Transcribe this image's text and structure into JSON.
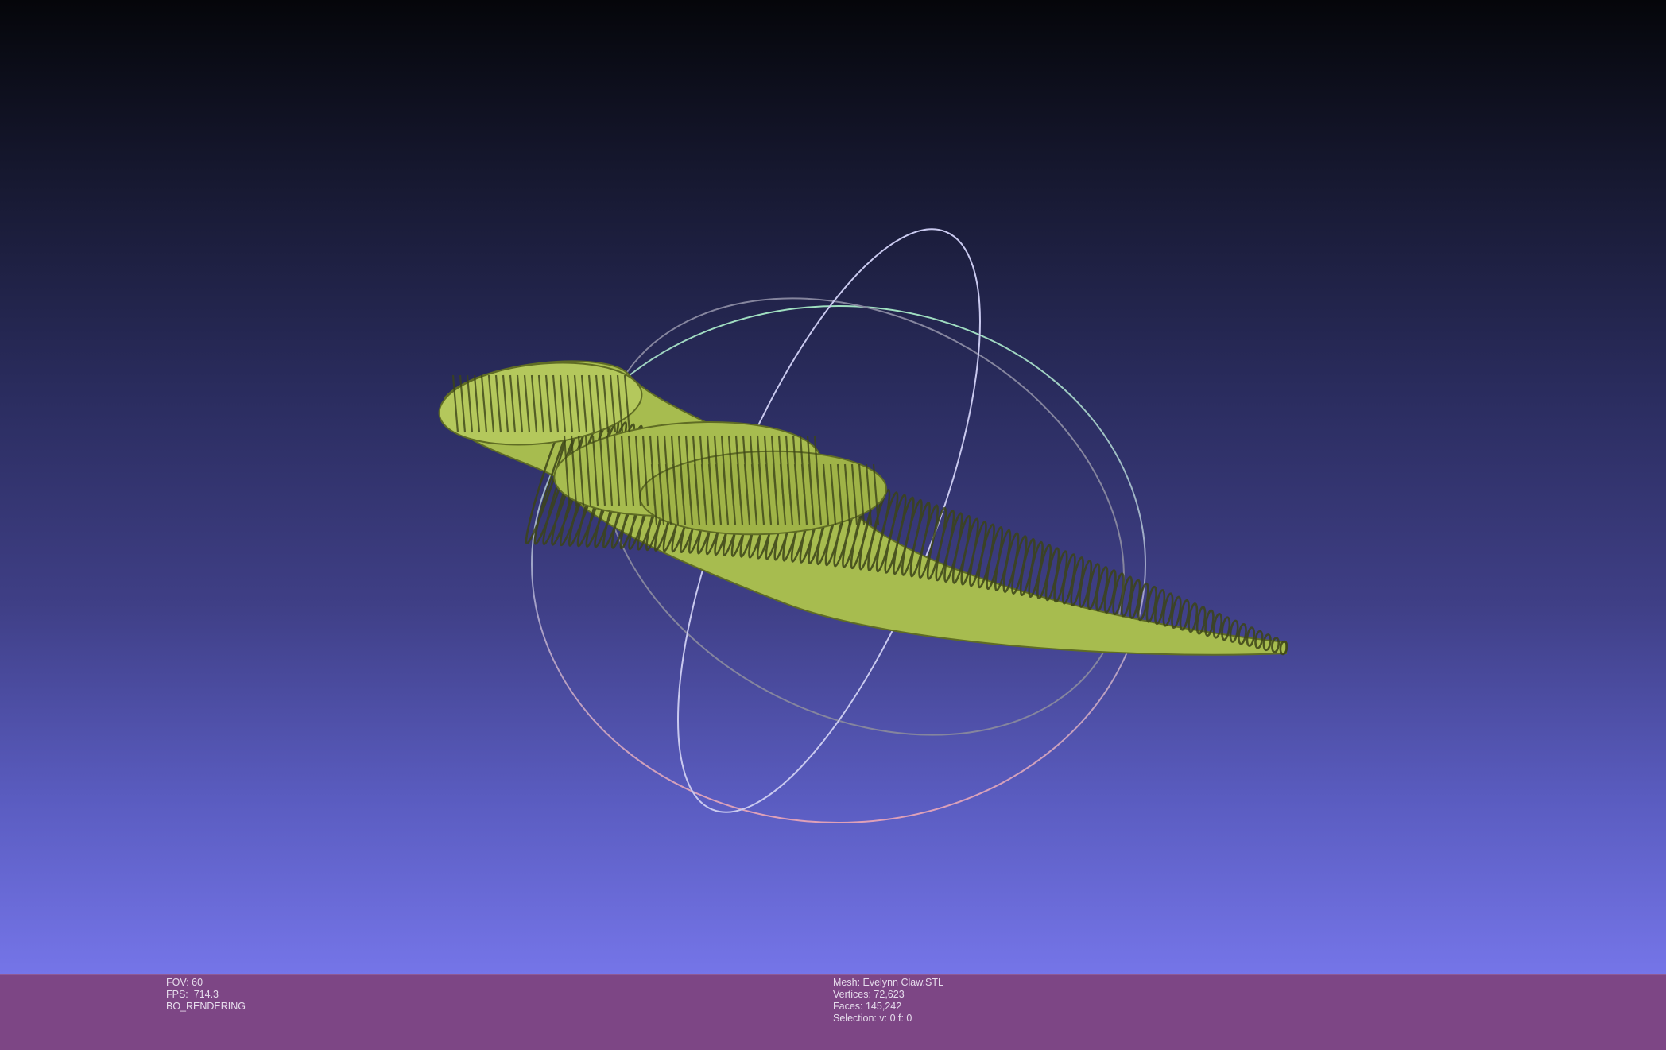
{
  "viewport": {
    "background_top": "#05060a",
    "background_bottom": "#7575e8",
    "model_color": "#a7bc4f",
    "trackball_colors": {
      "horizontal_top": "#9fe0c0",
      "horizontal_bottom": "#e0a0b8",
      "vertical": "#c8c8f0",
      "inner": "#8a8aa0"
    }
  },
  "info_left": {
    "fov": "FOV: 60",
    "fps": "FPS:  714.3",
    "mode": "BO_RENDERING"
  },
  "info_right": {
    "mesh": "Mesh: Evelynn Claw.STL",
    "vertices": "Vertices: 72,623",
    "faces": "Faces: 145,242",
    "selection": "Selection: v: 0 f: 0"
  },
  "infobar_color": "#7d4685"
}
